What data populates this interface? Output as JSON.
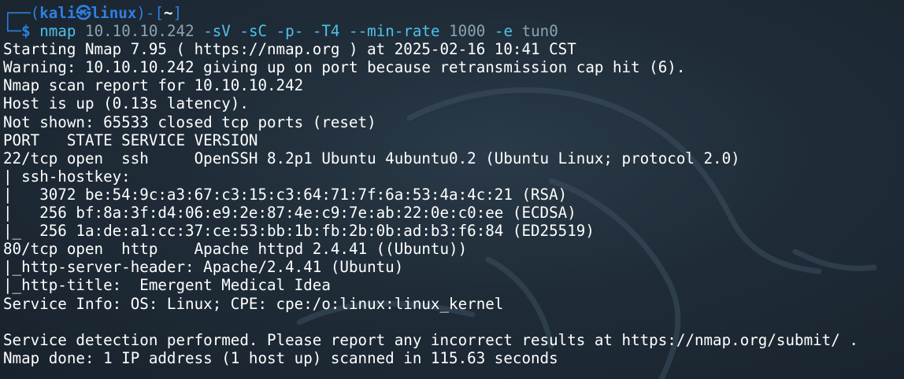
{
  "prompt": {
    "frame_top_left": "┌──(",
    "user": "kali",
    "at_symbol": "㉿",
    "host": "linux",
    "frame_mid": ")-[",
    "cwd": "~",
    "frame_close": "]",
    "frame_bottom_left": "└─",
    "dollar": "$"
  },
  "command": {
    "program": "nmap",
    "target": "10.10.10.242",
    "flags1": "-sV -sC -p- -T4 --min-rate",
    "rate": "1000",
    "flags2": "-e",
    "iface": "tun0"
  },
  "output": [
    "Starting Nmap 7.95 ( https://nmap.org ) at 2025-02-16 10:41 CST",
    "Warning: 10.10.10.242 giving up on port because retransmission cap hit (6).",
    "Nmap scan report for 10.10.10.242",
    "Host is up (0.13s latency).",
    "Not shown: 65533 closed tcp ports (reset)",
    "PORT   STATE SERVICE VERSION",
    "22/tcp open  ssh     OpenSSH 8.2p1 Ubuntu 4ubuntu0.2 (Ubuntu Linux; protocol 2.0)",
    "| ssh-hostkey: ",
    "|   3072 be:54:9c:a3:67:c3:15:c3:64:71:7f:6a:53:4a:4c:21 (RSA)",
    "|   256 bf:8a:3f:d4:06:e9:2e:87:4e:c9:7e:ab:22:0e:c0:ee (ECDSA)",
    "|_  256 1a:de:a1:cc:37:ce:53:bb:1b:fb:2b:0b:ad:b3:f6:84 (ED25519)",
    "80/tcp open  http    Apache httpd 2.4.41 ((Ubuntu))",
    "|_http-server-header: Apache/2.4.41 (Ubuntu)",
    "|_http-title:  Emergent Medical Idea",
    "Service Info: OS: Linux; CPE: cpe:/o:linux:linux_kernel",
    "",
    "Service detection performed. Please report any incorrect results at https://nmap.org/submit/ .",
    "Nmap done: 1 IP address (1 host up) scanned in 115.63 seconds"
  ]
}
